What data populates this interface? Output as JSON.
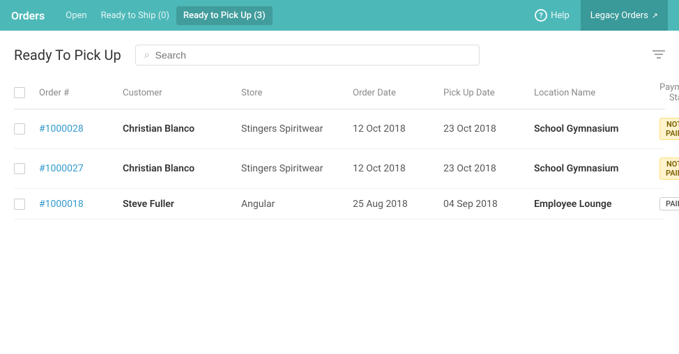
{
  "header": {
    "title": "Orders",
    "tabs": [
      {
        "id": "open",
        "label": "Open",
        "active": false
      },
      {
        "id": "ready-to-ship",
        "label": "Ready to Ship (0)",
        "active": false
      },
      {
        "id": "ready-to-pickup",
        "label": "Ready to Pick Up (3)",
        "active": true
      }
    ],
    "help_label": "Help",
    "legacy_orders_label": "Legacy Orders"
  },
  "page": {
    "title": "Ready To Pick Up",
    "search_placeholder": "Search"
  },
  "table": {
    "columns": {
      "order": "Order #",
      "customer": "Customer",
      "store": "Store",
      "order_date": "Order Date",
      "pickup_date": "Pick Up Date",
      "location": "Location Name",
      "payment": "Payment Status"
    },
    "rows": [
      {
        "id": "row-1",
        "order_num": "#1000028",
        "customer": "Christian Blanco",
        "store": "Stingers Spiritwear",
        "order_date": "12 Oct 2018",
        "pickup_date": "23 Oct 2018",
        "location": "School Gymnasium",
        "payment_status": "NOT PAID",
        "payment_type": "not-paid"
      },
      {
        "id": "row-2",
        "order_num": "#1000027",
        "customer": "Christian Blanco",
        "store": "Stingers Spiritwear",
        "order_date": "12 Oct 2018",
        "pickup_date": "23 Oct 2018",
        "location": "School Gymnasium",
        "payment_status": "NOT PAID",
        "payment_type": "not-paid"
      },
      {
        "id": "row-3",
        "order_num": "#1000018",
        "customer": "Steve Fuller",
        "store": "Angular",
        "order_date": "25 Aug 2018",
        "pickup_date": "04 Sep 2018",
        "location": "Employee Lounge",
        "payment_status": "PAID",
        "payment_type": "paid"
      }
    ]
  }
}
